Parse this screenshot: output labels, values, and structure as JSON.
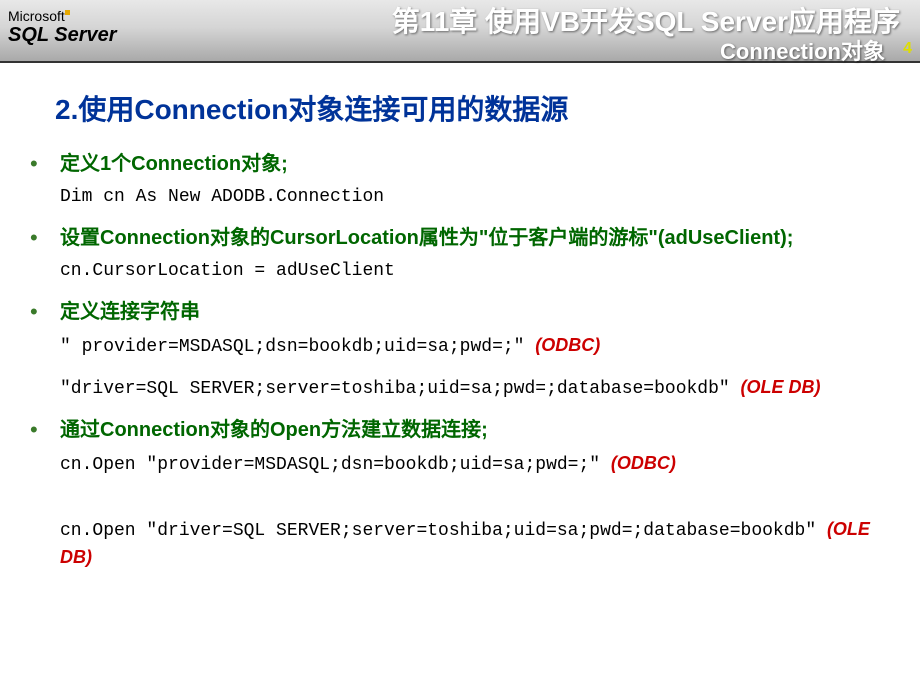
{
  "header": {
    "logo_ms": "Microsoft",
    "logo_sql": "SQL Server",
    "chapter": "第11章  使用VB开发SQL Server应用程序",
    "section": "Connection对象",
    "page": "4"
  },
  "title": "2.使用Connection对象连接可用的数据源",
  "items": {
    "b1": "定义1个Connection对象;",
    "c1": "Dim cn As New ADODB.Connection",
    "b2": "设置Connection对象的CursorLocation属性为\"位于客户端的游标\"(adUseClient);",
    "c2": "cn.CursorLocation = adUseClient",
    "b3": "定义连接字符串",
    "c3a": "\" provider=MSDASQL;dsn=bookdb;uid=sa;pwd=;\"",
    "c3a_note": "(ODBC)",
    "c3b": "\"driver=SQL SERVER;server=toshiba;uid=sa;pwd=;database=bookdb\"",
    "c3b_note": "(OLE DB)",
    "b4": "通过Connection对象的Open方法建立数据连接;",
    "c4a": "cn.Open \"provider=MSDASQL;dsn=bookdb;uid=sa;pwd=;\"",
    "c4a_note": "(ODBC)",
    "c4b": "cn.Open \"driver=SQL SERVER;server=toshiba;uid=sa;pwd=;database=bookdb\" ",
    "c4b_note": "(OLE DB)"
  }
}
